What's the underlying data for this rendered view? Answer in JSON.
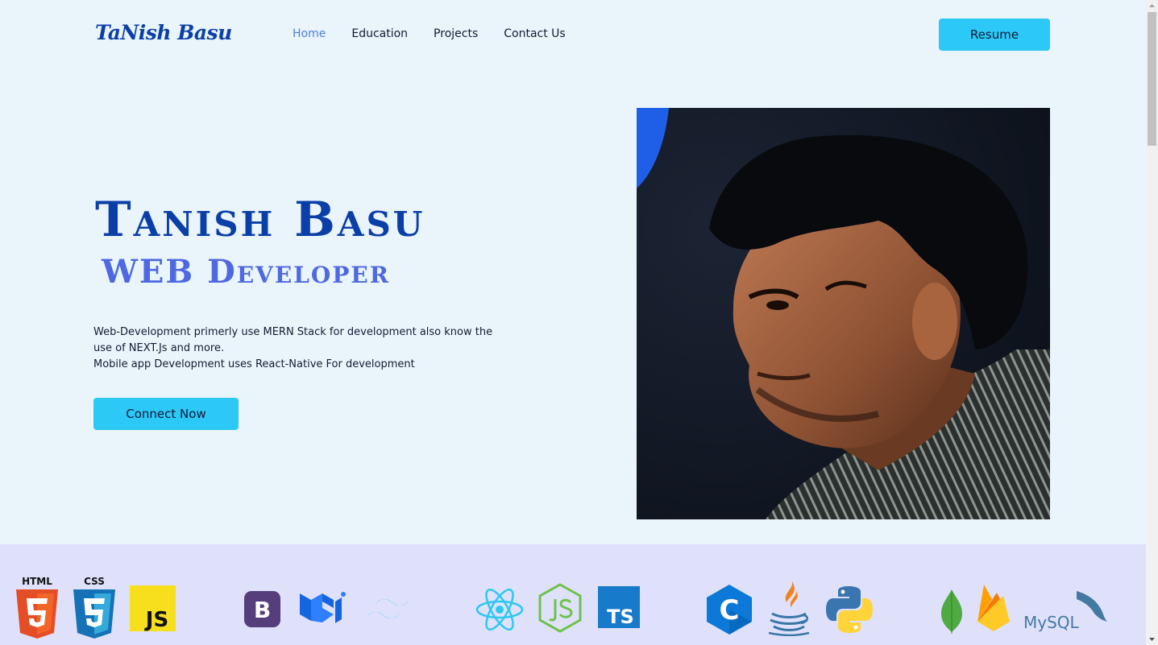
{
  "header": {
    "logo": "TaNish Basu",
    "nav": [
      {
        "label": "Home",
        "active": true
      },
      {
        "label": "Education",
        "active": false
      },
      {
        "label": "Projects",
        "active": false
      },
      {
        "label": "Contact Us",
        "active": false
      }
    ],
    "resume_label": "Resume"
  },
  "hero": {
    "name": "Tanish Basu",
    "role": "WEB Developer",
    "description": [
      "Web-Development primerly use MERN Stack for development also know the",
      "use of NEXT.Js and more.",
      "Mobile app Development uses React-Native For development"
    ],
    "connect_label": "Connect Now"
  },
  "skills": {
    "html_label": "HTML",
    "css_label": "CSS",
    "js_label": "JS",
    "bootstrap_label": "B",
    "ts_label": "TS",
    "c_label": "C",
    "mysql_label": "MySQL"
  },
  "colors": {
    "accent": "#2dc9f6",
    "brand": "#0b3fa8",
    "role": "#4d68e0",
    "nav_active": "#4d7fe0",
    "background": "#eaf4fb",
    "skills_bg": "#dfe1fb"
  }
}
